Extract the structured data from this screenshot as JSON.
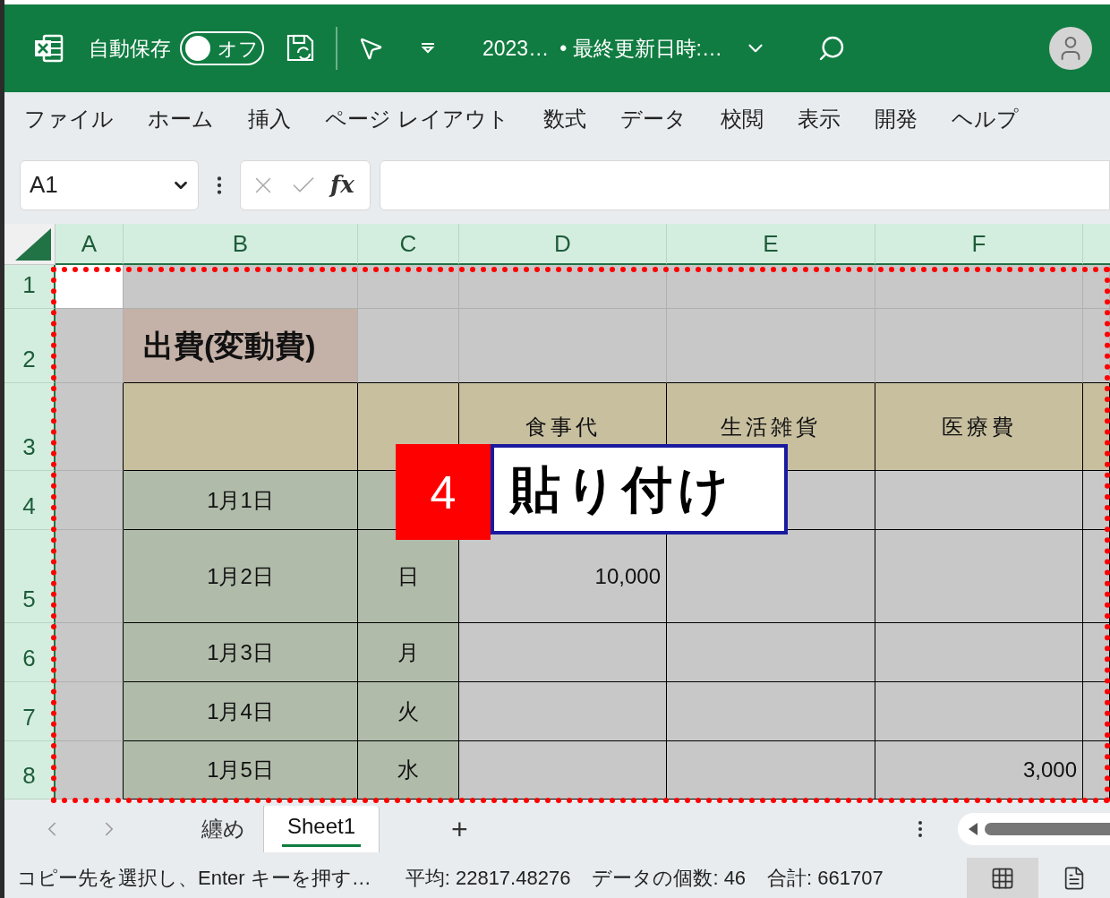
{
  "titlebar": {
    "autosave_label": "自動保存",
    "autosave": {
      "label": "オフ",
      "on": false
    },
    "file_name": "2023…",
    "status": "• 最終更新日時:…"
  },
  "menu": [
    "ファイル",
    "ホーム",
    "挿入",
    "ページ レイアウト",
    "数式",
    "データ",
    "校閲",
    "表示",
    "開発",
    "ヘルプ"
  ],
  "formula_bar": {
    "name_box": "A1",
    "function_label": "fx"
  },
  "columns": [
    {
      "label": "A",
      "selected": true
    },
    {
      "label": "B",
      "selected": true
    },
    {
      "label": "C",
      "selected": true
    },
    {
      "label": "D",
      "selected": true
    },
    {
      "label": "E",
      "selected": true
    },
    {
      "label": "F",
      "selected": true
    }
  ],
  "row_numbers": [
    "1",
    "2",
    "3",
    "4",
    "5",
    "6",
    "7",
    "8"
  ],
  "sheet": {
    "title": "出費(変動費)",
    "headers": [
      "食事代",
      "生活雑貨",
      "医療費"
    ],
    "rows": [
      {
        "date": "1月1日"
      },
      {
        "date": "1月2日",
        "weekday": "日",
        "values": {
          "D": "10,000"
        }
      },
      {
        "date": "1月3日",
        "weekday": "月"
      },
      {
        "date": "1月4日",
        "weekday": "火"
      },
      {
        "date": "1月5日",
        "weekday": "水",
        "values": {
          "F": "3,000"
        }
      }
    ]
  },
  "callout": {
    "number": "4",
    "text": "貼り付け"
  },
  "sheet_tabs": [
    {
      "label": "纏め",
      "selected": false
    },
    {
      "label": "Sheet1",
      "selected": true
    }
  ],
  "add_sheet": "+",
  "status_bar": {
    "message": "コピー先を選択し、Enter キーを押す…",
    "average": "平均: 22817.48276",
    "count": "データの個数: 46",
    "sum": "合計: 661707",
    "views": [
      {
        "kind": "normal",
        "selected": true
      },
      {
        "kind": "page",
        "selected": false
      }
    ]
  }
}
